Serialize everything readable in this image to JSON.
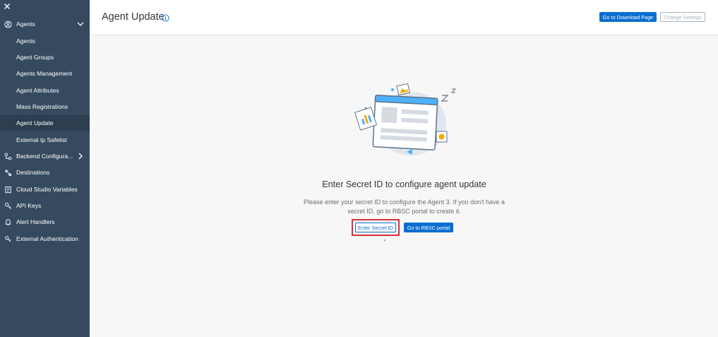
{
  "sidebar": {
    "close_icon": "close-icon",
    "items": [
      {
        "label": "Agents",
        "icon": "user-circle-icon"
      },
      {
        "label": "Agents"
      },
      {
        "label": "Agent Groups"
      },
      {
        "label": "Agents Management"
      },
      {
        "label": "Agent Attributes"
      },
      {
        "label": "Mass Registrations"
      },
      {
        "label": "Agent Update"
      },
      {
        "label": "External Ip Safelist"
      },
      {
        "label": "Backend Configura...",
        "icon": "backend-icon"
      },
      {
        "label": "Destinations",
        "icon": "destinations-icon"
      },
      {
        "label": "Cloud Studio Variables",
        "icon": "variables-icon"
      },
      {
        "label": "API Keys",
        "icon": "key-icon"
      },
      {
        "label": "Alert Handlers",
        "icon": "bell-icon"
      },
      {
        "label": "External Authentication",
        "icon": "external-auth-icon"
      }
    ],
    "active_label": "Agent Update"
  },
  "header": {
    "title": "Agent Update",
    "download_button": "Go to Download Page",
    "change_settings_button": "Change Settings"
  },
  "main": {
    "title": "Enter Secret ID to configure agent update",
    "description": "Please enter your secret ID to configure the Agent 3. If you don't have a secret ID, go to RBSC portal to create it.",
    "enter_secret_button": "Enter Secret ID",
    "rbsc_button": "Go to RBSC portal"
  },
  "colors": {
    "sidebar_bg": "#354a5f",
    "accent": "#0a6ed1",
    "highlight": "#d9303d"
  }
}
